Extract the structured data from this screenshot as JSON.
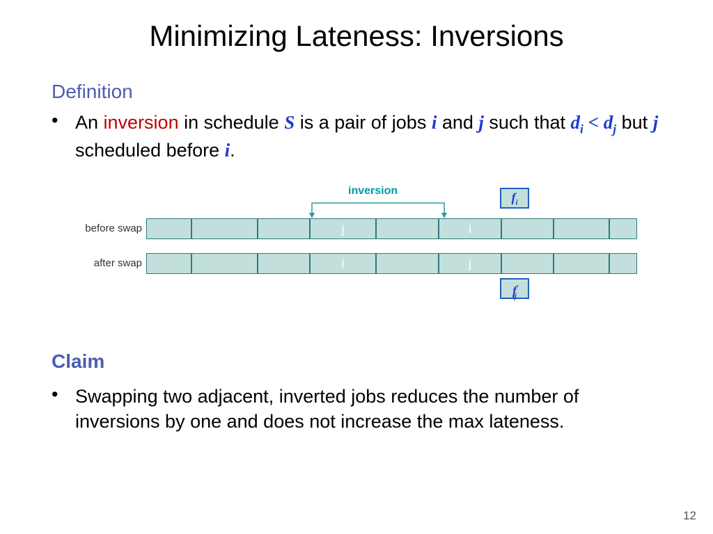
{
  "title": "Minimizing Lateness: Inversions",
  "definition": {
    "heading": "Definition",
    "bullet_pre": "An ",
    "bullet_keyword": "inversion",
    "bullet_mid1": " in schedule ",
    "var_S": "S",
    "bullet_mid2": " is a pair of jobs ",
    "var_i": "i",
    "bullet_mid3": " and ",
    "var_j": "j",
    "bullet_mid4": " such that ",
    "var_di": "d",
    "var_di_sub": "i",
    "bullet_lt": " < ",
    "var_dj": "d",
    "var_dj_sub": "j",
    "bullet_mid5": " but ",
    "var_j2": "j",
    "bullet_mid6": " scheduled before ",
    "var_i2": "i",
    "bullet_end": "."
  },
  "diagram": {
    "inversion_label": "inversion",
    "before_label": "before swap",
    "after_label": "after swap",
    "before_cells": [
      "",
      "",
      "",
      "j",
      "",
      "i",
      "",
      "",
      ""
    ],
    "after_cells": [
      "",
      "",
      "",
      "i",
      "",
      "j",
      "",
      "",
      ""
    ],
    "cell_widths": [
      65,
      95,
      75,
      95,
      90,
      90,
      75,
      80,
      40
    ],
    "f_i": "f",
    "f_i_sub": "i",
    "f_j": "f",
    "f_j_prime": "′",
    "f_j_sub": "j"
  },
  "claim": {
    "heading": "Claim",
    "bullet": "Swapping two adjacent, inverted jobs reduces the number of inversions by one and does not increase the max lateness."
  },
  "page": "12"
}
